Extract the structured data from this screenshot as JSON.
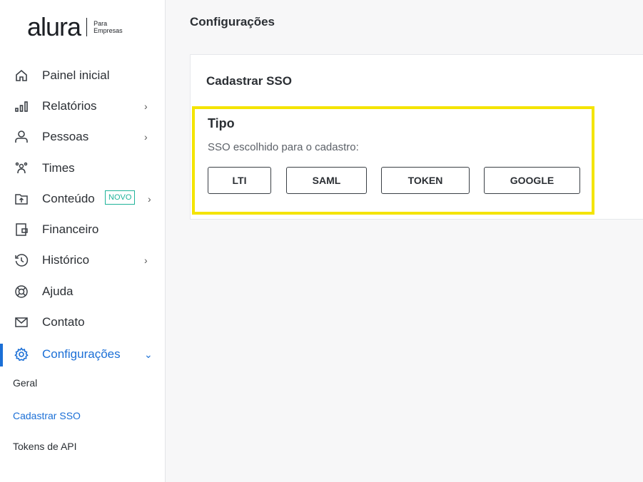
{
  "brand": {
    "name": "alura",
    "subtitle_line1": "Para",
    "subtitle_line2": "Empresas"
  },
  "sidebar": {
    "items": [
      {
        "label": "Painel inicial",
        "icon": "home-icon"
      },
      {
        "label": "Relatórios",
        "icon": "bar-chart-icon",
        "chevron": "›"
      },
      {
        "label": "Pessoas",
        "icon": "user-icon",
        "chevron": "›"
      },
      {
        "label": "Times",
        "icon": "team-icon"
      },
      {
        "label": "Conteúdo",
        "icon": "folder-upload-icon",
        "badge": "NOVO",
        "chevron": "›"
      },
      {
        "label": "Financeiro",
        "icon": "wallet-icon"
      },
      {
        "label": "Histórico",
        "icon": "history-icon",
        "chevron": "›"
      },
      {
        "label": "Ajuda",
        "icon": "lifebuoy-icon"
      },
      {
        "label": "Contato",
        "icon": "mail-icon"
      },
      {
        "label": "Configurações",
        "icon": "gear-icon",
        "chevron": "⌄"
      }
    ],
    "subitems": [
      {
        "label": "Geral"
      },
      {
        "label": "Cadastrar SSO"
      },
      {
        "label": "Tokens de API"
      }
    ]
  },
  "main": {
    "page_title": "Configurações",
    "card_title": "Cadastrar SSO",
    "tipo": {
      "title": "Tipo",
      "description": "SSO escolhido para o cadastro:",
      "buttons": [
        "LTI",
        "SAML",
        "TOKEN",
        "GOOGLE"
      ]
    }
  },
  "colors": {
    "accent": "#1b6fd6",
    "highlight": "#f4e400",
    "badge": "#1fb39a"
  }
}
